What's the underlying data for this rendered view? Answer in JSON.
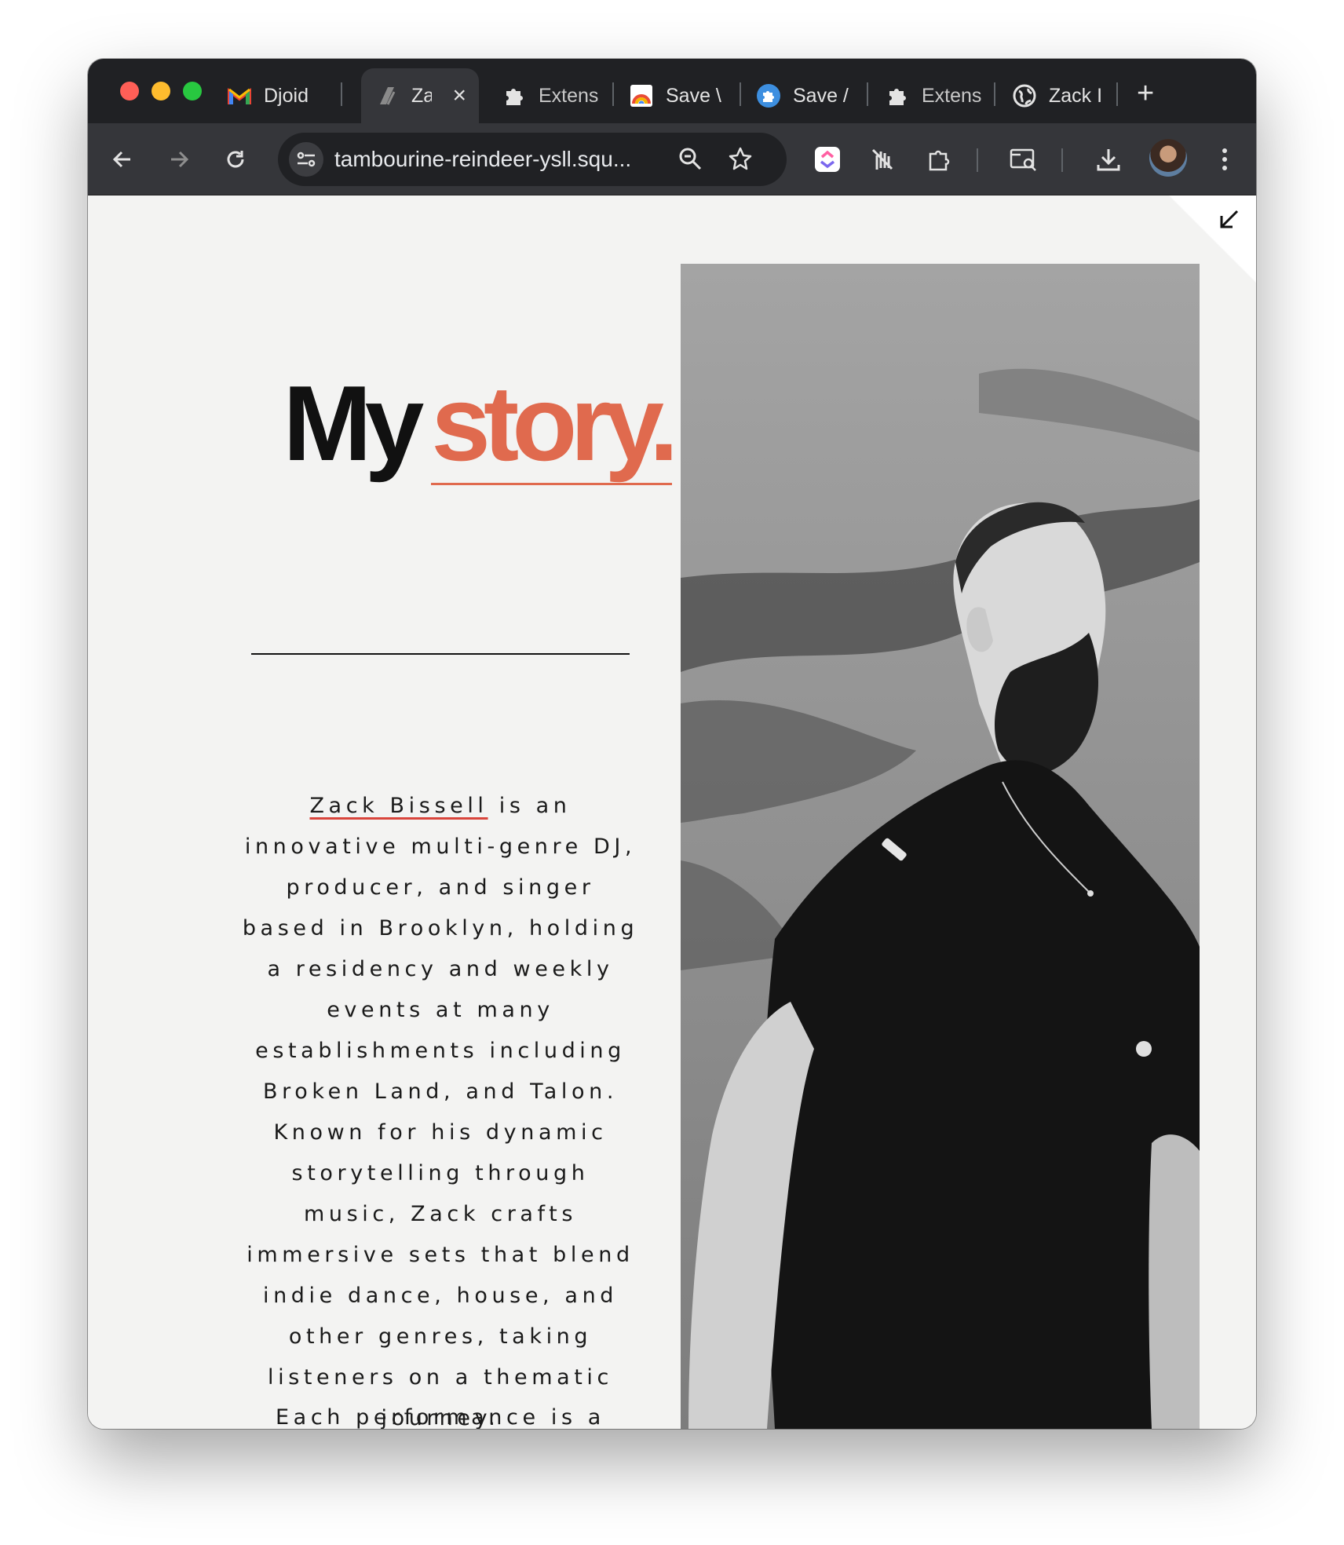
{
  "browser": {
    "tabs": [
      {
        "title": "Djoid",
        "icon": "gmail-icon",
        "active": false
      },
      {
        "title": "Za",
        "icon": "squarespace-icon",
        "active": true
      },
      {
        "title": "Extens",
        "icon": "puzzle-icon",
        "active": false
      },
      {
        "title": "Save \\",
        "icon": "rainbow-icon",
        "active": false
      },
      {
        "title": "Save /",
        "icon": "puzzle-blue-icon",
        "active": false
      },
      {
        "title": "Extens",
        "icon": "puzzle-icon",
        "active": false
      },
      {
        "title": "Zack I",
        "icon": "globe-icon",
        "active": false
      }
    ],
    "new_tab_label": "+",
    "close_label": "×",
    "url": "tambourine-reindeer-ysll.squ..."
  },
  "page": {
    "headline_black": "My",
    "headline_accent": "story.",
    "bio_name": "Zack Bissell",
    "bio_rest": " is an innovative multi-genre DJ, producer, and singer based in Brooklyn, holding a residency and weekly events at many establishments including Broken Land, and Talon. Known for his dynamic storytelling through music, Zack crafts immersive sets that blend indie dance, house, and other genres, taking listeners on a thematic journey.",
    "next_paragraph": "Each performance is a"
  },
  "colors": {
    "accent": "#e06a4e",
    "underline_red": "#d9453c",
    "page_bg": "#f3f3f2",
    "chrome_dark": "#202124",
    "chrome_toolbar": "#35363a"
  }
}
